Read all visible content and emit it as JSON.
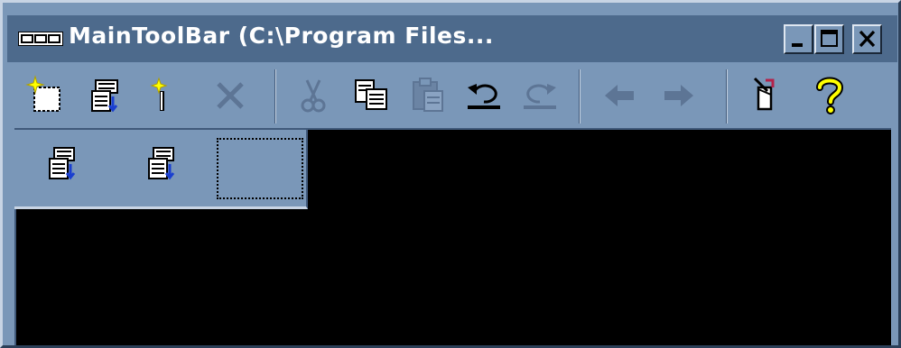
{
  "window": {
    "title": "MainToolBar (C:\\Program Files...",
    "app_icon": "toolbar-app-icon",
    "controls": [
      {
        "name": "minimize-button",
        "icon": "minimize-icon"
      },
      {
        "name": "maximize-button",
        "icon": "maximize-icon"
      },
      {
        "name": "close-button",
        "icon": "close-icon"
      }
    ]
  },
  "toolbar": {
    "groups": [
      [
        {
          "name": "new-button",
          "icon": "new-document-icon",
          "enabled": true
        },
        {
          "name": "properties-button",
          "icon": "properties-icon",
          "enabled": true
        },
        {
          "name": "wizard-button",
          "icon": "magic-wand-icon",
          "enabled": true
        },
        {
          "name": "delete-button",
          "icon": "delete-x-icon",
          "enabled": false
        }
      ],
      [
        {
          "name": "cut-button",
          "icon": "scissors-icon",
          "enabled": false
        },
        {
          "name": "copy-button",
          "icon": "copy-icon",
          "enabled": true
        },
        {
          "name": "paste-button",
          "icon": "paste-icon",
          "enabled": false
        },
        {
          "name": "undo-button",
          "icon": "undo-icon",
          "enabled": true
        },
        {
          "name": "redo-button",
          "icon": "redo-icon",
          "enabled": false
        }
      ],
      [
        {
          "name": "back-button",
          "icon": "back-arrow-icon",
          "enabled": false
        },
        {
          "name": "forward-button",
          "icon": "forward-arrow-icon",
          "enabled": false
        }
      ],
      [
        {
          "name": "context-help-button",
          "icon": "pointer-help-icon",
          "enabled": true
        },
        {
          "name": "help-button",
          "icon": "question-mark-icon",
          "enabled": true
        }
      ]
    ]
  },
  "sub_toolbar": {
    "buttons": [
      {
        "name": "import-button-1",
        "icon": "import-properties-icon"
      },
      {
        "name": "import-button-2",
        "icon": "import-properties-icon"
      }
    ],
    "empty_slot": "empty-button-slot"
  },
  "colors": {
    "chrome": "#7a97b8",
    "titlebar": "#4d6a8c",
    "client": "#000000",
    "disabled_icon": "#5d7595",
    "highlight_yellow": "#ffff00"
  }
}
